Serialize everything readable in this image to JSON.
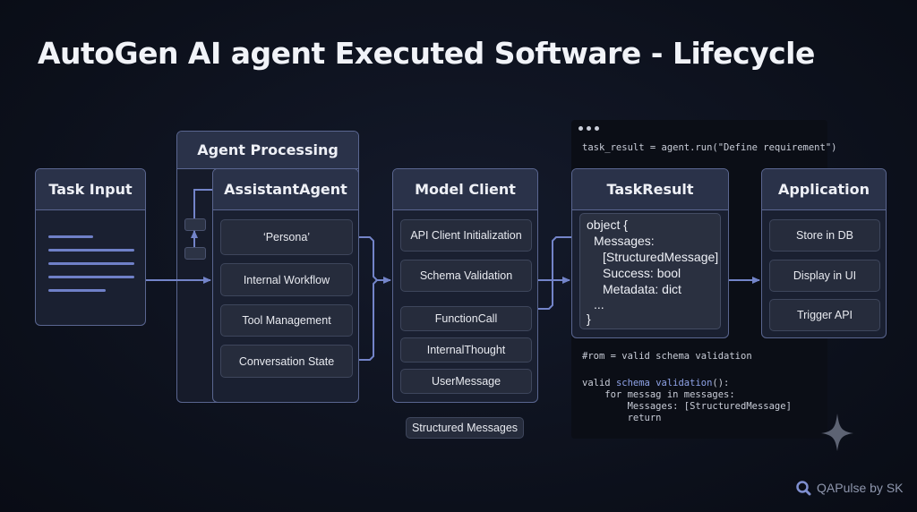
{
  "title": "AutoGen AI agent Executed Software - Lifecycle",
  "task_input": {
    "header": "Task Input"
  },
  "agent_processing": {
    "header": "Agent Processing"
  },
  "assistant_agent": {
    "header": "AssistantAgent",
    "items": [
      "‘Persona’",
      "Internal Workflow",
      "Tool Management",
      "Conversation State"
    ]
  },
  "model_client": {
    "header": "Model Client",
    "items": [
      "API Client Initialization",
      "Schema Validation",
      "FunctionCall",
      "InternalThought",
      "UserMessage"
    ],
    "caption": "Structured Messages"
  },
  "code_panel": {
    "top_line": "task_result = agent.run(\"Define requirement\")",
    "comment_line": "#rom = valid schema validation",
    "def_prefix": "valid ",
    "def_name": "schema validation",
    "def_suffix": "():",
    "for_line": "    for messag in messages:",
    "messages_line": "        Messages: [StructuredMessage]",
    "return_line": "        return"
  },
  "task_result": {
    "header": "TaskResult",
    "lines": [
      "object {",
      "Messages:",
      "[StructuredMessage]",
      "Success: bool",
      "Metadata: dict",
      "...",
      "}"
    ]
  },
  "application": {
    "header": "Application",
    "items": [
      "Store in DB",
      "Display in UI",
      "Trigger API"
    ]
  },
  "brand": {
    "label": "QAPulse by SK"
  },
  "colors": {
    "accent": "#7384c9",
    "panel_border": "#5a6690",
    "background": "#0e1220"
  }
}
